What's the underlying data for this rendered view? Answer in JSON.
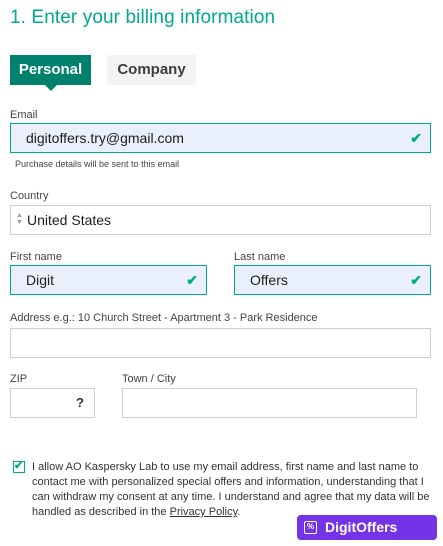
{
  "heading": "1. Enter your billing information",
  "tabs": [
    {
      "label": "Personal",
      "active": true
    },
    {
      "label": "Company",
      "active": false
    }
  ],
  "email": {
    "label": "Email",
    "value": "digitoffers.try@gmail.com",
    "hint": "Purchase details will be sent to this email"
  },
  "country": {
    "label": "Country",
    "value": "United States"
  },
  "first_name": {
    "label": "First name",
    "value": "Digit"
  },
  "last_name": {
    "label": "Last name",
    "value": "Offers"
  },
  "address": {
    "label": "Address e.g.: 10 Church Street - Apartment 3 - Park Residence",
    "value": ""
  },
  "zip": {
    "label": "ZIP",
    "value": "",
    "help": "?"
  },
  "city": {
    "label": "Town / City",
    "value": ""
  },
  "consent": {
    "checked": true,
    "text": "I allow AO Kaspersky Lab to use my email address, first name and last name to contact me with personalized special offers and information, understanding that I can withdraw my consent at any time. I understand and agree that my data will be handled as described in the ",
    "link": "Privacy Policy",
    "end": "."
  },
  "watermark": {
    "text": "DigitOffers",
    "icon": "%"
  },
  "colors": {
    "accent": "#00a88e",
    "tab_active": "#00816d",
    "valid_bg": "#e9f0fb",
    "badge": "#7433e6"
  }
}
